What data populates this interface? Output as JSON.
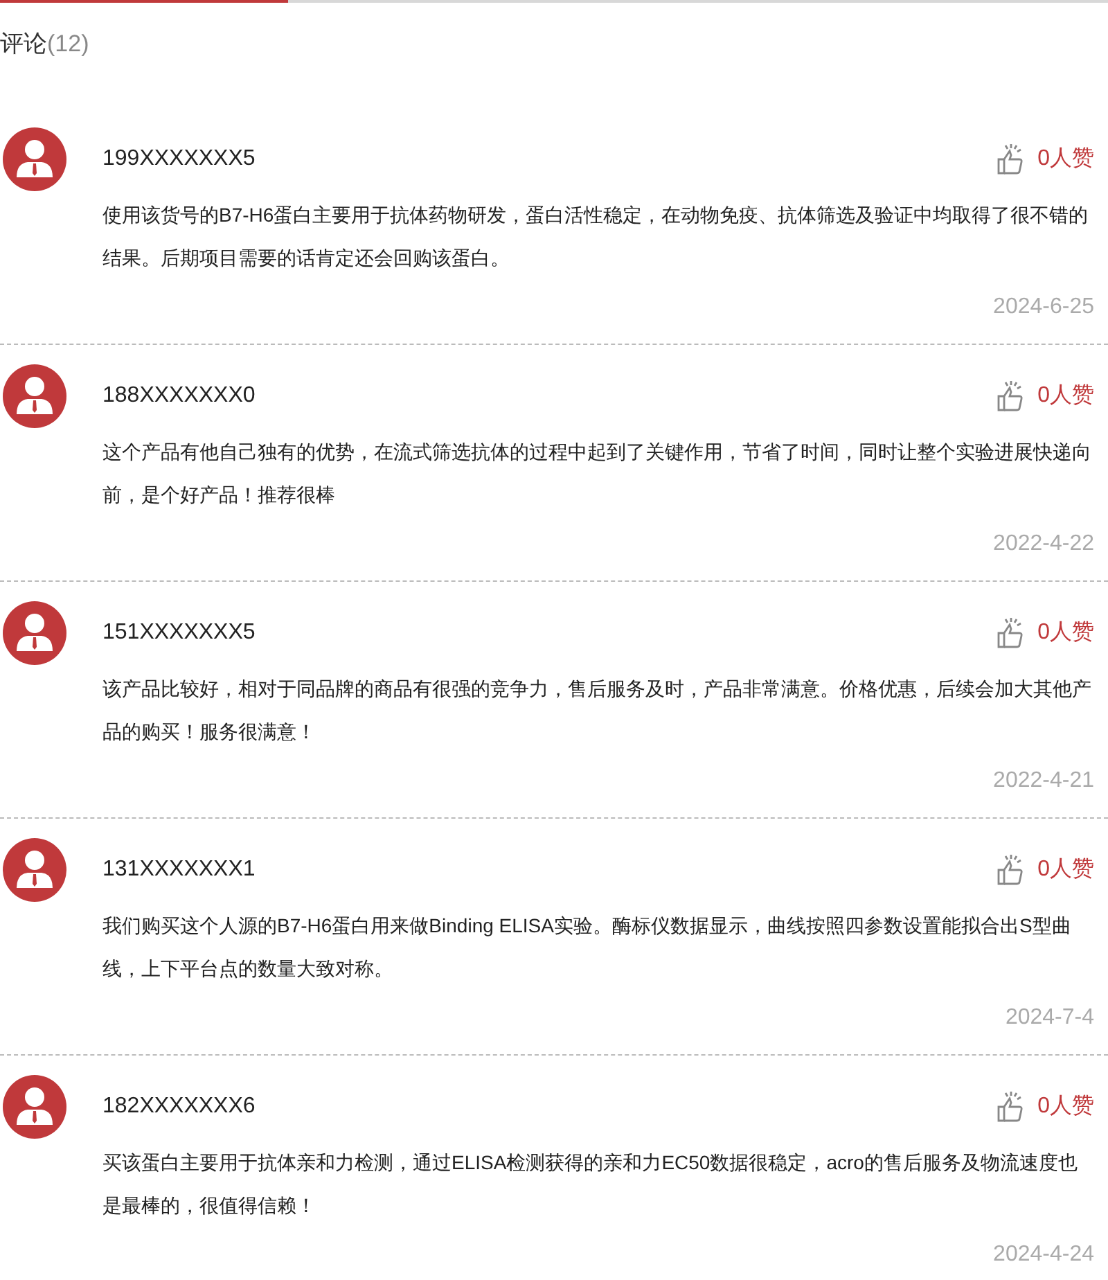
{
  "header": {
    "title": "评论",
    "count": "(12)"
  },
  "comments": [
    {
      "user": "199XXXXXXX5",
      "likes": "0人赞",
      "text": "使用该货号的B7-H6蛋白主要用于抗体药物研发，蛋白活性稳定，在动物免疫、抗体筛选及验证中均取得了很不错的结果。后期项目需要的话肯定还会回购该蛋白。",
      "date": "2024-6-25"
    },
    {
      "user": "188XXXXXXX0",
      "likes": "0人赞",
      "text": "这个产品有他自己独有的优势，在流式筛选抗体的过程中起到了关键作用，节省了时间，同时让整个实验进展快递向前，是个好产品！推荐很棒",
      "date": "2022-4-22"
    },
    {
      "user": "151XXXXXXX5",
      "likes": "0人赞",
      "text": "该产品比较好，相对于同品牌的商品有很强的竞争力，售后服务及时，产品非常满意。价格优惠，后续会加大其他产品的购买！服务很满意！",
      "date": "2022-4-21"
    },
    {
      "user": "131XXXXXXX1",
      "likes": "0人赞",
      "text": "我们购买这个人源的B7-H6蛋白用来做Binding ELISA实验。酶标仪数据显示，曲线按照四参数设置能拟合出S型曲线，上下平台点的数量大致对称。",
      "date": "2024-7-4"
    },
    {
      "user": "182XXXXXXX6",
      "likes": "0人赞",
      "text": "买该蛋白主要用于抗体亲和力检测，通过ELISA检测获得的亲和力EC50数据很稳定，acro的售后服务及物流速度也是最棒的，很值得信赖！",
      "date": "2024-4-24"
    }
  ]
}
